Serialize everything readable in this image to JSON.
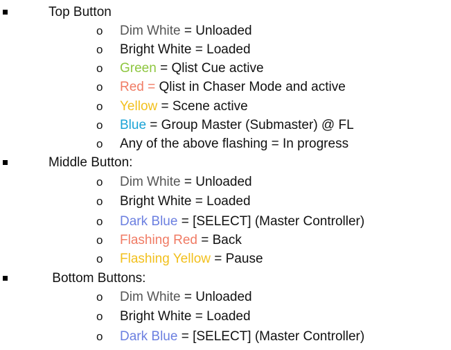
{
  "sections": [
    {
      "heading": "Top Button",
      "items": [
        {
          "key": "Dim White",
          "rest": " = Unloaded",
          "key_color": "#555555"
        },
        {
          "key": "Bright White",
          "rest": " = Loaded",
          "key_color": "#111111"
        },
        {
          "key": "Green",
          "rest": " = Qlist Cue active",
          "key_color": "#8ec63f"
        },
        {
          "key": "Red =",
          "rest": " Qlist in Chaser Mode and active",
          "key_color": "#f07b64"
        },
        {
          "key": "Yellow",
          "rest": " = Scene active",
          "key_color": "#f2c01d"
        },
        {
          "key": "Blue",
          "rest": " = Group Master (Submaster) @ FL",
          "key_color": "#1aa3d6"
        },
        {
          "key": "Any of the above flashing",
          "rest": " = In progress",
          "key_color": "#111111"
        }
      ]
    },
    {
      "heading": "Middle Button:",
      "items": [
        {
          "key": "Dim White",
          "rest": " = Unloaded",
          "key_color": "#555555"
        },
        {
          "key": "Bright White",
          "rest": " = Loaded",
          "key_color": "#111111"
        },
        {
          "key": "Dark Blue",
          "rest": " = [SELECT] (Master Controller)",
          "key_color": "#6b7fe0"
        },
        {
          "key": "Flashing Red",
          "rest": " = Back",
          "key_color": "#f07b64"
        },
        {
          "key": "Flashing Yellow",
          "rest": " = Pause",
          "key_color": "#f2c01d"
        }
      ]
    },
    {
      "heading": " Bottom Buttons:",
      "items": [
        {
          "key": "Dim White",
          "rest": " = Unloaded",
          "key_color": "#555555"
        },
        {
          "key": "Bright White",
          "rest": " = Loaded",
          "key_color": "#111111"
        },
        {
          "key": "Dark Blue",
          "rest": " = [SELECT] (Master Controller)",
          "key_color": "#6b7fe0"
        }
      ]
    }
  ],
  "sub_bullet_glyph": "o"
}
